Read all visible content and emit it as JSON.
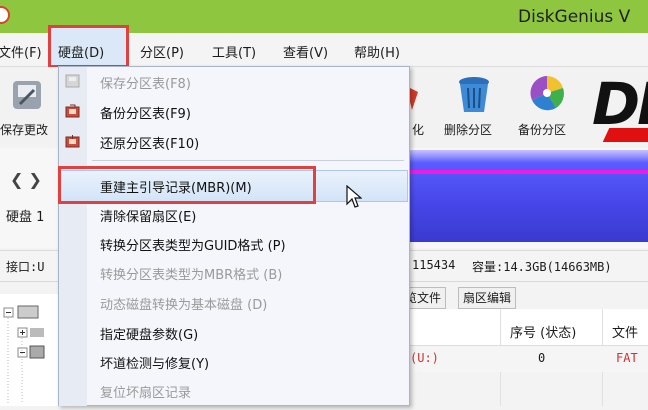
{
  "window": {
    "title": "DiskGenius V"
  },
  "menubar": {
    "items": [
      {
        "label": "文件(F)"
      },
      {
        "label": "硬盘(D)"
      },
      {
        "label": "分区(P)"
      },
      {
        "label": "工具(T)"
      },
      {
        "label": "查看(V)"
      },
      {
        "label": "帮助(H)"
      }
    ]
  },
  "toolbar": {
    "save_label": "保存更改",
    "format_label": "化",
    "delete_partition_label": "删除分区",
    "backup_partition_label": "备份分区",
    "logo_text": "DI"
  },
  "diskbar": {
    "disk_label": "硬盘 1"
  },
  "info": {
    "interface": "接口:U",
    "sectors": "115434",
    "capacity": "容量:14.3GB(14663MB)"
  },
  "tabs": [
    {
      "label": "览文件"
    },
    {
      "label": "扇区编辑"
    }
  ],
  "table": {
    "headers": {
      "seq": "序号 (状态)",
      "file": "文件"
    },
    "row": {
      "name": "(U:)",
      "seq": "0",
      "fs": "FAT"
    }
  },
  "dropdown": {
    "items": [
      {
        "label": "保存分区表(F8)",
        "enabled": false
      },
      {
        "label": "备份分区表(F9)",
        "enabled": true
      },
      {
        "label": "还原分区表(F10)",
        "enabled": true
      },
      {
        "label": "重建主引导记录(MBR)(M)",
        "enabled": true,
        "highlighted": true
      },
      {
        "label": "清除保留扇区(E)",
        "enabled": true
      },
      {
        "label": "转换分区表类型为GUID格式 (P)",
        "enabled": true
      },
      {
        "label": "转换分区表类型为MBR格式 (B)",
        "enabled": false
      },
      {
        "label": "动态磁盘转换为基本磁盘 (D)",
        "enabled": false
      },
      {
        "label": "指定硬盘参数(G)",
        "enabled": true
      },
      {
        "label": "坏道检测与修复(Y)",
        "enabled": true
      },
      {
        "label": "复位坏扇区记录",
        "enabled": false
      }
    ]
  },
  "colors": {
    "titlebar": "#8ec63f",
    "highlight_box": "#e04040",
    "disk_bar": "#4646e8"
  }
}
